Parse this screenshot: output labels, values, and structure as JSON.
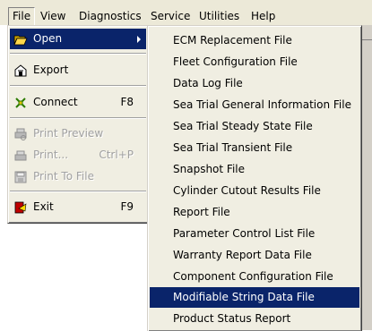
{
  "menubar": {
    "items": [
      {
        "label": "File"
      },
      {
        "label": "View"
      },
      {
        "label": "Diagnostics"
      },
      {
        "label": "Service"
      },
      {
        "label": "Utilities"
      },
      {
        "label": "Help"
      }
    ]
  },
  "file_menu": {
    "items": [
      {
        "label": "Open",
        "icon": "open-folder-icon",
        "highlighted": true,
        "has_submenu": true
      },
      {
        "label": "Export",
        "icon": "export-icon"
      },
      {
        "label": "Connect",
        "icon": "connect-icon",
        "shortcut": "F8"
      },
      {
        "label": "Print Preview",
        "icon": "print-preview-icon",
        "disabled": true
      },
      {
        "label": "Print...",
        "icon": "printer-icon",
        "shortcut": "Ctrl+P",
        "disabled": true
      },
      {
        "label": "Print To File",
        "icon": "print-to-file-icon",
        "disabled": true
      },
      {
        "label": "Exit",
        "icon": "exit-icon",
        "shortcut": "F9"
      }
    ]
  },
  "open_submenu": {
    "items": [
      {
        "label": "ECM Replacement File"
      },
      {
        "label": "Fleet Configuration File"
      },
      {
        "label": "Data Log File"
      },
      {
        "label": "Sea Trial General Information File"
      },
      {
        "label": "Sea Trial Steady State File"
      },
      {
        "label": "Sea Trial Transient File"
      },
      {
        "label": "Snapshot File"
      },
      {
        "label": "Cylinder Cutout Results File"
      },
      {
        "label": "Report File"
      },
      {
        "label": "Parameter Control List File"
      },
      {
        "label": "Warranty Report Data File"
      },
      {
        "label": "Component Configuration File"
      },
      {
        "label": "Modifiable String Data File",
        "highlighted": true
      },
      {
        "label": "Product Status Report"
      }
    ]
  },
  "colors": {
    "menu_background": "#f0eee2",
    "highlight": "#0a246a",
    "disabled_text": "#a0a0a0"
  }
}
